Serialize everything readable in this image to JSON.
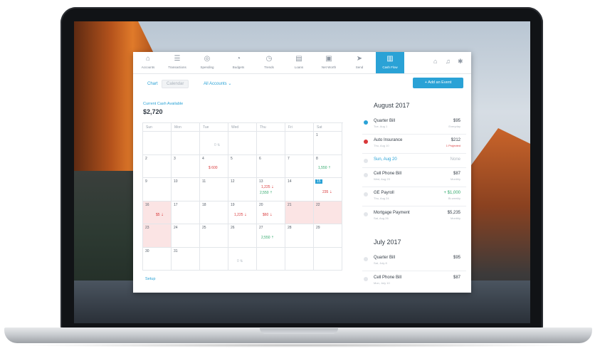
{
  "nav": {
    "items": [
      {
        "label": "Accounts",
        "icon": "bank-icon",
        "glyph": "⌂"
      },
      {
        "label": "Transactions",
        "icon": "list-icon",
        "glyph": "☰"
      },
      {
        "label": "Spending",
        "icon": "donut-icon",
        "glyph": "◎"
      },
      {
        "label": "Budgets",
        "icon": "pie-icon",
        "glyph": "◔"
      },
      {
        "label": "Trends",
        "icon": "clock-icon",
        "glyph": "◷"
      },
      {
        "label": "Loans",
        "icon": "document-icon",
        "glyph": "▤"
      },
      {
        "label": "Net Worth",
        "icon": "briefcase-icon",
        "glyph": "▣"
      },
      {
        "label": "Send",
        "icon": "send-icon",
        "glyph": "➤"
      },
      {
        "label": "Cash Flow",
        "icon": "cash-flow-icon",
        "glyph": "▥"
      }
    ],
    "right_icons": [
      {
        "icon": "home-icon",
        "glyph": "⌂"
      },
      {
        "icon": "bell-icon",
        "glyph": "♫"
      },
      {
        "icon": "gear-icon",
        "glyph": "✱"
      }
    ]
  },
  "tabs": {
    "chart": "Chart",
    "calendar": "Calendar"
  },
  "accounts_filter": "All Accounts ⌄",
  "cash": {
    "label": "Current Cash Available",
    "value": "$2,720"
  },
  "calendar": {
    "days": [
      "Sun",
      "Mon",
      "Tue",
      "Wed",
      "Thu",
      "Fri",
      "Sat"
    ],
    "rows": [
      [
        "",
        "",
        "",
        "",
        "",
        "",
        "1"
      ],
      [
        "2",
        "3",
        "4",
        "5",
        "6",
        "7",
        "8"
      ],
      [
        "9",
        "10",
        "11",
        "12",
        "13",
        "14",
        "15"
      ],
      [
        "16",
        "17",
        "18",
        "19",
        "20",
        "21",
        "22"
      ],
      [
        "23",
        "24",
        "25",
        "26",
        "27",
        "28",
        "29"
      ],
      [
        "30",
        "31",
        "",
        "",
        "",
        "",
        ""
      ]
    ],
    "amounts": {
      "tue_wk1": "0 ⇅",
      "tue_wk2": "$ 600",
      "sat_wk2": "1,550 ⇡",
      "thu_wk3_a": "1,225 ⇣",
      "thu_wk3_b": "2,550 ⇡",
      "sat_wk3": "235 ⇣",
      "sun_wk4": "$5 ⇣",
      "wed_wk4": "1,225 ⇣",
      "thu_wk4": "$60 ⇣",
      "thu_wk5": "2,550 ⇡",
      "tue_wk6": "0 ⇅"
    }
  },
  "setup": "Setup",
  "sidebar": {
    "add_button": "+ Add an Event",
    "month1": "August 2017",
    "month2": "July 2017",
    "events": [
      {
        "name": "Quarter Bill",
        "sub": "Tue, Aug 1",
        "value": "$95",
        "vsub": "Everyday"
      },
      {
        "name": "Auto Insurance",
        "sub": "Thu, Aug 10",
        "value": "$212",
        "vsub": "1 Projected"
      },
      {
        "name": "Sun, Aug 20",
        "sub": "",
        "value": "None",
        "vsub": ""
      },
      {
        "name": "Cell Phone Bill",
        "sub": "Wed, Aug 23",
        "value": "$87",
        "vsub": "Monthly"
      },
      {
        "name": "GE Payroll",
        "sub": "Thu, Aug 24",
        "value": "+ $1,000",
        "vsub": "Bi-weekly"
      },
      {
        "name": "Mortgage Payment",
        "sub": "Sat, Aug 26",
        "value": "$5,235",
        "vsub": "Monthly"
      },
      {
        "name": "Quarter Bill",
        "sub": "Sat, July 8",
        "value": "$95",
        "vsub": ""
      },
      {
        "name": "Cell Phone Bill",
        "sub": "Mon, July 10",
        "value": "$87",
        "vsub": ""
      }
    ]
  },
  "colors": {
    "accent": "#2aa2d6",
    "negative": "#d9383a",
    "positive": "#2fa86a"
  }
}
